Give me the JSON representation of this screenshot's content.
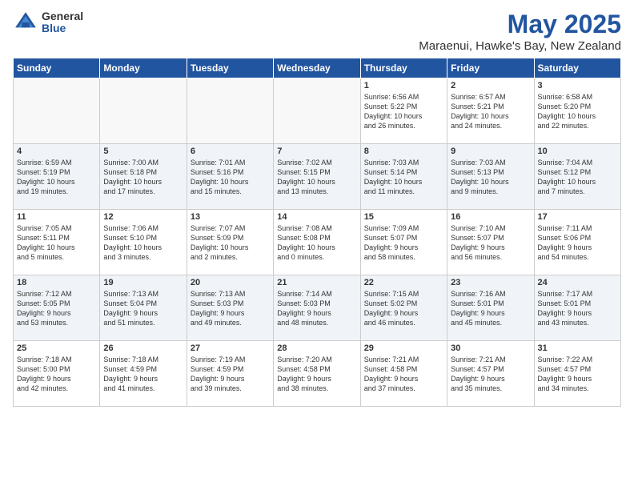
{
  "header": {
    "logo_general": "General",
    "logo_blue": "Blue",
    "month_title": "May 2025",
    "location": "Maraenui, Hawke's Bay, New Zealand"
  },
  "days_of_week": [
    "Sunday",
    "Monday",
    "Tuesday",
    "Wednesday",
    "Thursday",
    "Friday",
    "Saturday"
  ],
  "weeks": [
    [
      {
        "day": "",
        "info": ""
      },
      {
        "day": "",
        "info": ""
      },
      {
        "day": "",
        "info": ""
      },
      {
        "day": "",
        "info": ""
      },
      {
        "day": "1",
        "info": "Sunrise: 6:56 AM\nSunset: 5:22 PM\nDaylight: 10 hours\nand 26 minutes."
      },
      {
        "day": "2",
        "info": "Sunrise: 6:57 AM\nSunset: 5:21 PM\nDaylight: 10 hours\nand 24 minutes."
      },
      {
        "day": "3",
        "info": "Sunrise: 6:58 AM\nSunset: 5:20 PM\nDaylight: 10 hours\nand 22 minutes."
      }
    ],
    [
      {
        "day": "4",
        "info": "Sunrise: 6:59 AM\nSunset: 5:19 PM\nDaylight: 10 hours\nand 19 minutes."
      },
      {
        "day": "5",
        "info": "Sunrise: 7:00 AM\nSunset: 5:18 PM\nDaylight: 10 hours\nand 17 minutes."
      },
      {
        "day": "6",
        "info": "Sunrise: 7:01 AM\nSunset: 5:16 PM\nDaylight: 10 hours\nand 15 minutes."
      },
      {
        "day": "7",
        "info": "Sunrise: 7:02 AM\nSunset: 5:15 PM\nDaylight: 10 hours\nand 13 minutes."
      },
      {
        "day": "8",
        "info": "Sunrise: 7:03 AM\nSunset: 5:14 PM\nDaylight: 10 hours\nand 11 minutes."
      },
      {
        "day": "9",
        "info": "Sunrise: 7:03 AM\nSunset: 5:13 PM\nDaylight: 10 hours\nand 9 minutes."
      },
      {
        "day": "10",
        "info": "Sunrise: 7:04 AM\nSunset: 5:12 PM\nDaylight: 10 hours\nand 7 minutes."
      }
    ],
    [
      {
        "day": "11",
        "info": "Sunrise: 7:05 AM\nSunset: 5:11 PM\nDaylight: 10 hours\nand 5 minutes."
      },
      {
        "day": "12",
        "info": "Sunrise: 7:06 AM\nSunset: 5:10 PM\nDaylight: 10 hours\nand 3 minutes."
      },
      {
        "day": "13",
        "info": "Sunrise: 7:07 AM\nSunset: 5:09 PM\nDaylight: 10 hours\nand 2 minutes."
      },
      {
        "day": "14",
        "info": "Sunrise: 7:08 AM\nSunset: 5:08 PM\nDaylight: 10 hours\nand 0 minutes."
      },
      {
        "day": "15",
        "info": "Sunrise: 7:09 AM\nSunset: 5:07 PM\nDaylight: 9 hours\nand 58 minutes."
      },
      {
        "day": "16",
        "info": "Sunrise: 7:10 AM\nSunset: 5:07 PM\nDaylight: 9 hours\nand 56 minutes."
      },
      {
        "day": "17",
        "info": "Sunrise: 7:11 AM\nSunset: 5:06 PM\nDaylight: 9 hours\nand 54 minutes."
      }
    ],
    [
      {
        "day": "18",
        "info": "Sunrise: 7:12 AM\nSunset: 5:05 PM\nDaylight: 9 hours\nand 53 minutes."
      },
      {
        "day": "19",
        "info": "Sunrise: 7:13 AM\nSunset: 5:04 PM\nDaylight: 9 hours\nand 51 minutes."
      },
      {
        "day": "20",
        "info": "Sunrise: 7:13 AM\nSunset: 5:03 PM\nDaylight: 9 hours\nand 49 minutes."
      },
      {
        "day": "21",
        "info": "Sunrise: 7:14 AM\nSunset: 5:03 PM\nDaylight: 9 hours\nand 48 minutes."
      },
      {
        "day": "22",
        "info": "Sunrise: 7:15 AM\nSunset: 5:02 PM\nDaylight: 9 hours\nand 46 minutes."
      },
      {
        "day": "23",
        "info": "Sunrise: 7:16 AM\nSunset: 5:01 PM\nDaylight: 9 hours\nand 45 minutes."
      },
      {
        "day": "24",
        "info": "Sunrise: 7:17 AM\nSunset: 5:01 PM\nDaylight: 9 hours\nand 43 minutes."
      }
    ],
    [
      {
        "day": "25",
        "info": "Sunrise: 7:18 AM\nSunset: 5:00 PM\nDaylight: 9 hours\nand 42 minutes."
      },
      {
        "day": "26",
        "info": "Sunrise: 7:18 AM\nSunset: 4:59 PM\nDaylight: 9 hours\nand 41 minutes."
      },
      {
        "day": "27",
        "info": "Sunrise: 7:19 AM\nSunset: 4:59 PM\nDaylight: 9 hours\nand 39 minutes."
      },
      {
        "day": "28",
        "info": "Sunrise: 7:20 AM\nSunset: 4:58 PM\nDaylight: 9 hours\nand 38 minutes."
      },
      {
        "day": "29",
        "info": "Sunrise: 7:21 AM\nSunset: 4:58 PM\nDaylight: 9 hours\nand 37 minutes."
      },
      {
        "day": "30",
        "info": "Sunrise: 7:21 AM\nSunset: 4:57 PM\nDaylight: 9 hours\nand 35 minutes."
      },
      {
        "day": "31",
        "info": "Sunrise: 7:22 AM\nSunset: 4:57 PM\nDaylight: 9 hours\nand 34 minutes."
      }
    ]
  ]
}
